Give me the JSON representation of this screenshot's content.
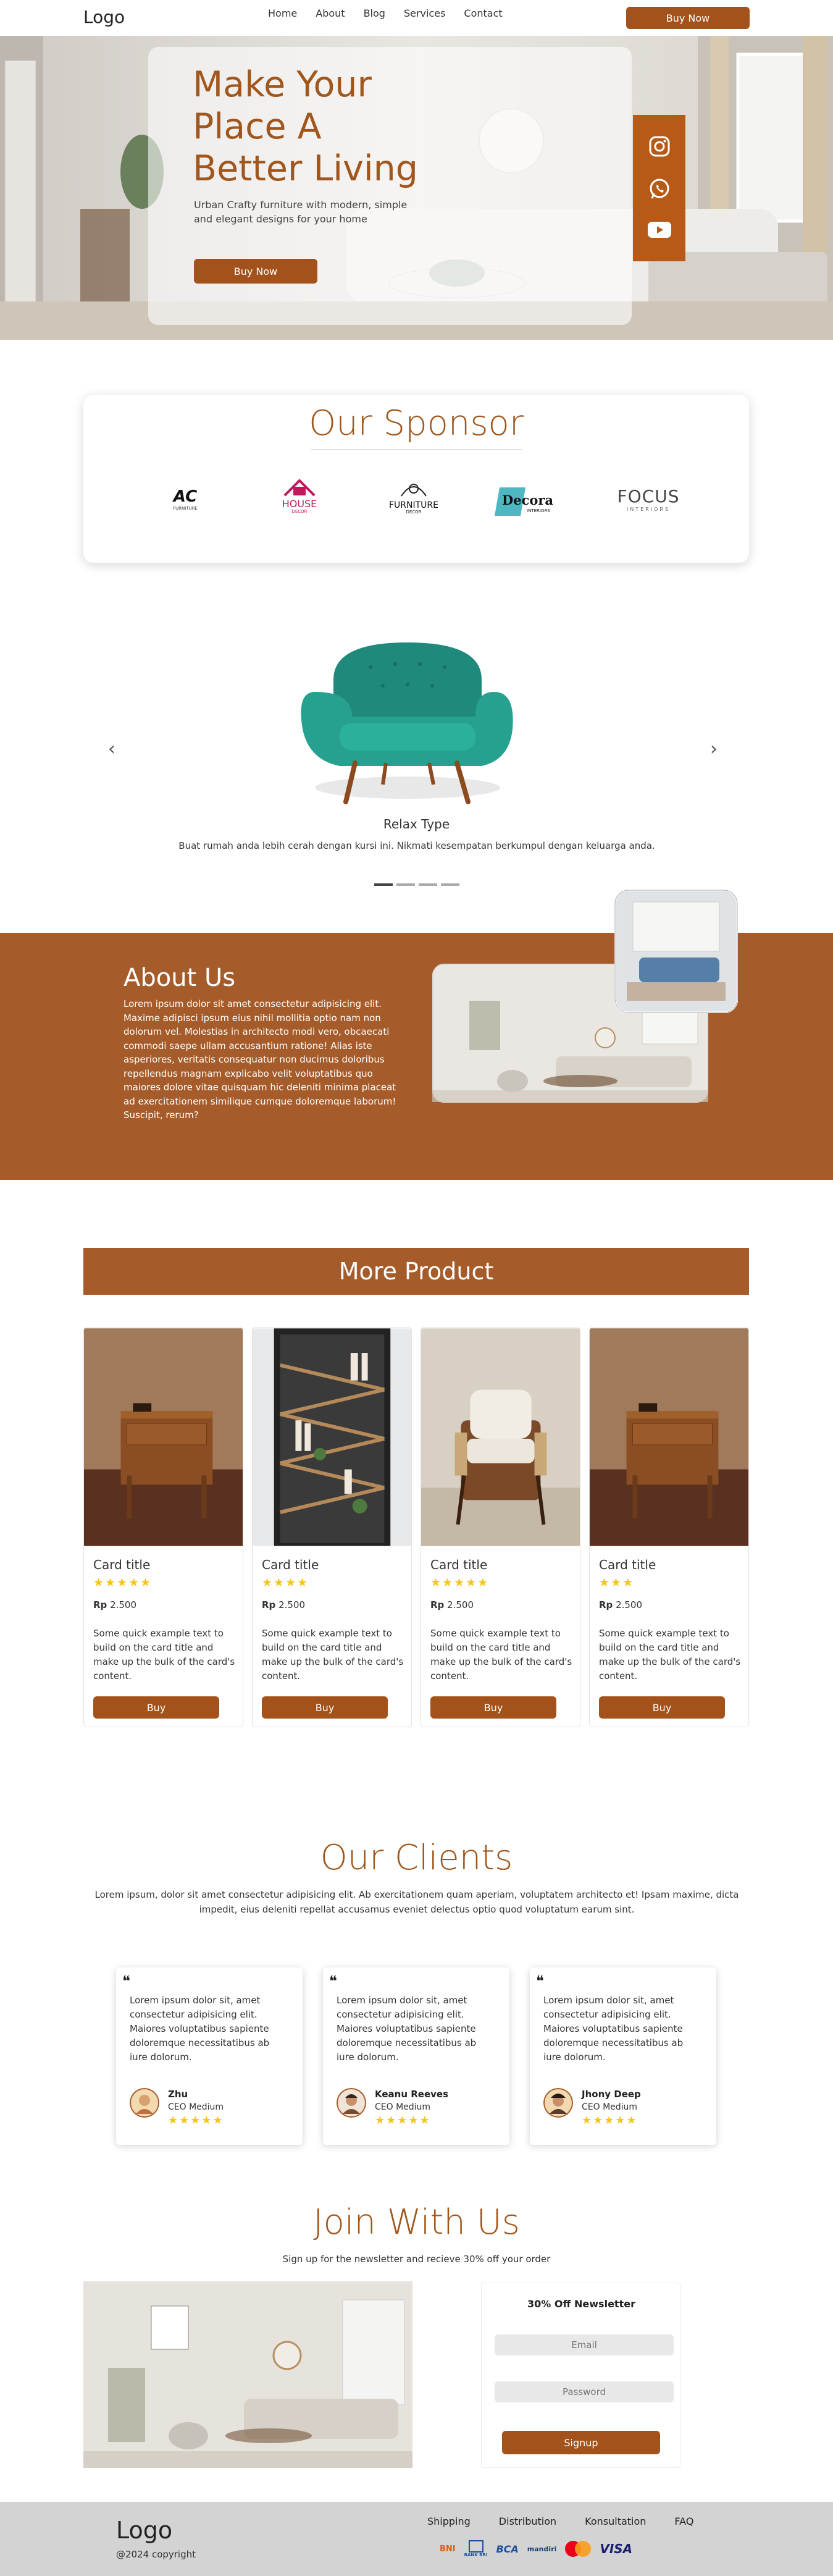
{
  "nav": {
    "logo": "Logo",
    "links": [
      "Home",
      "About",
      "Blog",
      "Services",
      "Contact"
    ],
    "buy_label": "Buy Now"
  },
  "hero": {
    "title_lines": [
      "Make Your",
      "Place A",
      "Better Living"
    ],
    "subtitle": "Urban Crafty furniture with modern, simple and elegant designs for your home",
    "button_label": "Buy Now",
    "social_icons": [
      "instagram-icon",
      "whatsapp-icon",
      "youtube-icon"
    ]
  },
  "sponsor": {
    "title": "Our Sponsor",
    "logos": [
      {
        "name": "ac-furniture-logo",
        "text_main": "AC",
        "text_sub": "FURNITURE"
      },
      {
        "name": "house-decor-logo",
        "text_main": "HOUSE",
        "text_sub": "DECOR"
      },
      {
        "name": "furniture-logo",
        "text_main": "FURNITURE",
        "text_sub": "DECOR"
      },
      {
        "name": "decora-logo",
        "text_main": "Decora",
        "text_sub": "INTERIORS"
      },
      {
        "name": "focus-interiors-logo",
        "text_main": "FOCUS",
        "text_sub": "INTERIORS"
      }
    ]
  },
  "carousel": {
    "title": "Relax Type",
    "caption": "Buat rumah anda lebih cerah dengan kursi ini. Nikmati kesempatan berkumpul dengan keluarga anda.",
    "active_index": 0,
    "slide_count": 4
  },
  "about": {
    "title": "About Us",
    "body": "Lorem ipsum dolor sit amet consectetur adipisicing elit. Maxime adipisci ipsum eius nihil mollitia optio nam non dolorum vel. Molestias in architecto modi vero, obcaecati commodi saepe ullam accusantium ratione! Alias iste asperiores, veritatis consequatur non ducimus doloribus repellendus magnam explicabo velit voluptatibus quo maiores dolore vitae quisquam hic deleniti minima placeat ad exercitationem similique cumque doloremque laborum! Suscipit, rerum?"
  },
  "products": {
    "title": "More Product",
    "cards": [
      {
        "title": "Card title",
        "rating": 5,
        "currency": "Rp",
        "price": "2.500",
        "desc": "Some quick example text to build on the card title and make up the bulk of the card's content.",
        "buy": "Buy",
        "image": "nightstand"
      },
      {
        "title": "Card title",
        "rating": 4,
        "currency": "Rp",
        "price": "2.500",
        "desc": "Some quick example text to build on the card title and make up the bulk of the card's content.",
        "buy": "Buy",
        "image": "bookshelf"
      },
      {
        "title": "Card title",
        "rating": 5,
        "currency": "Rp",
        "price": "2.500",
        "desc": "Some quick example text to build on the card title and make up the bulk of the card's content.",
        "buy": "Buy",
        "image": "armchair"
      },
      {
        "title": "Card title",
        "rating": 3,
        "currency": "Rp",
        "price": "2.500",
        "desc": "Some quick example text to build on the card title and make up the bulk of the card's content.",
        "buy": "Buy",
        "image": "nightstand"
      }
    ]
  },
  "clients": {
    "title": "Our Clients",
    "intro": "Lorem ipsum, dolor sit amet consectetur adipisicing elit. Ab exercitationem quam aperiam, voluptatem architecto et! Ipsam maxime, dicta impedit, eius deleniti repellat accusamus eveniet delectus optio quod voluptatum earum sint.",
    "testimonials": [
      {
        "text": "Lorem ipsum dolor sit, amet consectetur adipisicing elit. Maiores voluptatibus sapiente doloremque necessitatibus ab iure dolorum.",
        "name": "Zhu",
        "role": "CEO Medium",
        "rating": 5
      },
      {
        "text": "Lorem ipsum dolor sit, amet consectetur adipisicing elit. Maiores voluptatibus sapiente doloremque necessitatibus ab iure dolorum.",
        "name": "Keanu Reeves",
        "role": "CEO Medium",
        "rating": 5
      },
      {
        "text": "Lorem ipsum dolor sit, amet consectetur adipisicing elit. Maiores voluptatibus sapiente doloremque necessitatibus ab iure dolorum.",
        "name": "Jhony Deep",
        "role": "CEO Medium",
        "rating": 5
      }
    ]
  },
  "join": {
    "title": "Join With Us",
    "subtitle": "Sign up for the newsletter and recieve 30% off your order",
    "newsletter_title": "30% Off Newsletter",
    "email_placeholder": "Email",
    "password_placeholder": "Password",
    "signup_label": "Signup"
  },
  "footer": {
    "logo": "Logo",
    "copyright": "@2024 copyright",
    "links": [
      "Shipping",
      "Distribution",
      "Konsultation",
      "FAQ"
    ],
    "payments": [
      "BNI",
      "BANK BRI",
      "BCA",
      "mandiri",
      "mastercard",
      "VISA"
    ]
  },
  "colors": {
    "brand": "#a2521a",
    "section_bg": "#a65c2a",
    "star": "#f4c61c",
    "footer_bg": "#d3d3d3"
  }
}
